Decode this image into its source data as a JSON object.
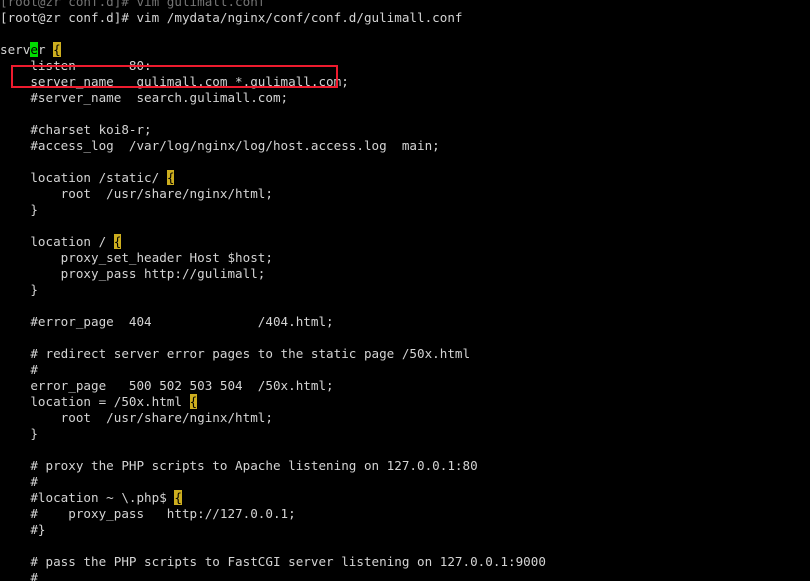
{
  "terminal": {
    "shell_prompt_prev": "[root@zr conf.d]# vim gulimall.conf",
    "shell_prompt": "[root@zr conf.d]# vim /mydata/nginx/conf/conf.d/gulimall.conf",
    "colors": {
      "background": "#000000",
      "foreground": "#d4d4d4",
      "cursor_bg": "#00dd00",
      "cursor_fg": "#000000",
      "brace_match_bg": "#cdae1f",
      "brace_match_fg": "#000000",
      "highlight_box": "#ee1b2e"
    }
  },
  "editor": {
    "name": "vim",
    "file_path": "/mydata/nginx/conf/conf.d/gulimall.conf",
    "cursor": {
      "line": 1,
      "column": 5,
      "char": "e"
    },
    "lines": [
      {
        "id": "l1a",
        "pre": "serv",
        "cursor": "e",
        "post": "r ",
        "brace": "{",
        "tail": ""
      },
      {
        "id": "l2",
        "text": "    listen       80:"
      },
      {
        "id": "l3",
        "text": "    server_name   gulimall.com *.gulimall.com;"
      },
      {
        "id": "l4",
        "text": "    #server_name  search.gulimall.com;"
      },
      {
        "id": "l5",
        "text": ""
      },
      {
        "id": "l6",
        "text": "    #charset koi8-r;"
      },
      {
        "id": "l7",
        "text": "    #access_log  /var/log/nginx/log/host.access.log  main;"
      },
      {
        "id": "l8",
        "text": ""
      },
      {
        "id": "l9a",
        "pre": "    location /static/ ",
        "brace": "{",
        "tail": ""
      },
      {
        "id": "l10",
        "text": "        root  /usr/share/nginx/html;"
      },
      {
        "id": "l11",
        "text": "    }"
      },
      {
        "id": "l12",
        "text": ""
      },
      {
        "id": "l13a",
        "pre": "    location / ",
        "brace": "{",
        "tail": ""
      },
      {
        "id": "l14",
        "text": "        proxy_set_header Host $host;"
      },
      {
        "id": "l15",
        "text": "        proxy_pass http://gulimall;"
      },
      {
        "id": "l16",
        "text": "    }"
      },
      {
        "id": "l17",
        "text": ""
      },
      {
        "id": "l18",
        "text": "    #error_page  404              /404.html;"
      },
      {
        "id": "l19",
        "text": ""
      },
      {
        "id": "l20",
        "text": "    # redirect server error pages to the static page /50x.html"
      },
      {
        "id": "l21",
        "text": "    #"
      },
      {
        "id": "l22",
        "text": "    error_page   500 502 503 504  /50x.html;"
      },
      {
        "id": "l23a",
        "pre": "    location = /50x.html ",
        "brace": "{",
        "tail": ""
      },
      {
        "id": "l24",
        "text": "        root  /usr/share/nginx/html;"
      },
      {
        "id": "l25",
        "text": "    }"
      },
      {
        "id": "l26",
        "text": ""
      },
      {
        "id": "l27",
        "text": "    # proxy the PHP scripts to Apache listening on 127.0.0.1:80"
      },
      {
        "id": "l28",
        "text": "    #"
      },
      {
        "id": "l29a",
        "pre": "    #location ~ \\.php$ ",
        "brace": "{",
        "tail": ""
      },
      {
        "id": "l30",
        "text": "    #    proxy_pass   http://127.0.0.1;"
      },
      {
        "id": "l31",
        "text": "    #}"
      },
      {
        "id": "l32",
        "text": ""
      },
      {
        "id": "l33",
        "text": "    # pass the PHP scripts to FastCGI server listening on 127.0.0.1:9000"
      },
      {
        "id": "l34",
        "text": "    #"
      }
    ]
  },
  "annotation": {
    "highlight_label": "server_name",
    "highlight_target_line": "    server_name   gulimall.com *.gulimall.com;"
  }
}
